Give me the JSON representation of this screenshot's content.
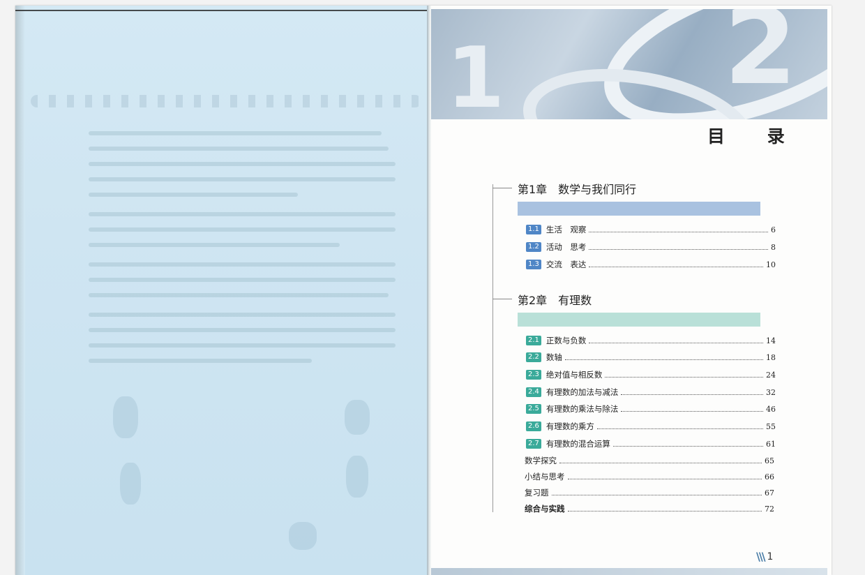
{
  "toc": {
    "title": "目 录",
    "page_number": "1",
    "page_mark_icon": "triple-slash-icon"
  },
  "chapters": [
    {
      "heading": "第1章　数学与我们同行",
      "bar_color": "#a9c2e0",
      "badge_color": "#4f86c6",
      "entries": [
        {
          "num": "1.1",
          "title": "生活　观察",
          "page": "6"
        },
        {
          "num": "1.2",
          "title": "活动　思考",
          "page": "8"
        },
        {
          "num": "1.3",
          "title": "交流　表达",
          "page": "10"
        }
      ]
    },
    {
      "heading": "第2章　有理数",
      "bar_color": "#b9e0d8",
      "badge_color": "#3aaa9a",
      "entries": [
        {
          "num": "2.1",
          "title": "正数与负数",
          "page": "14"
        },
        {
          "num": "2.2",
          "title": "数轴",
          "page": "18"
        },
        {
          "num": "2.3",
          "title": "绝对值与相反数",
          "page": "24"
        },
        {
          "num": "2.4",
          "title": "有理数的加法与减法",
          "page": "32"
        },
        {
          "num": "2.5",
          "title": "有理数的乘法与除法",
          "page": "46"
        },
        {
          "num": "2.6",
          "title": "有理数的乘方",
          "page": "55"
        },
        {
          "num": "2.7",
          "title": "有理数的混合运算",
          "page": "61"
        }
      ],
      "extras": [
        {
          "title": "数学探究",
          "page": "65"
        },
        {
          "title": "小结与思考",
          "page": "66"
        },
        {
          "title": "复习题",
          "page": "67"
        },
        {
          "title": "综合与实践",
          "page": "72",
          "bold": true
        }
      ]
    }
  ]
}
